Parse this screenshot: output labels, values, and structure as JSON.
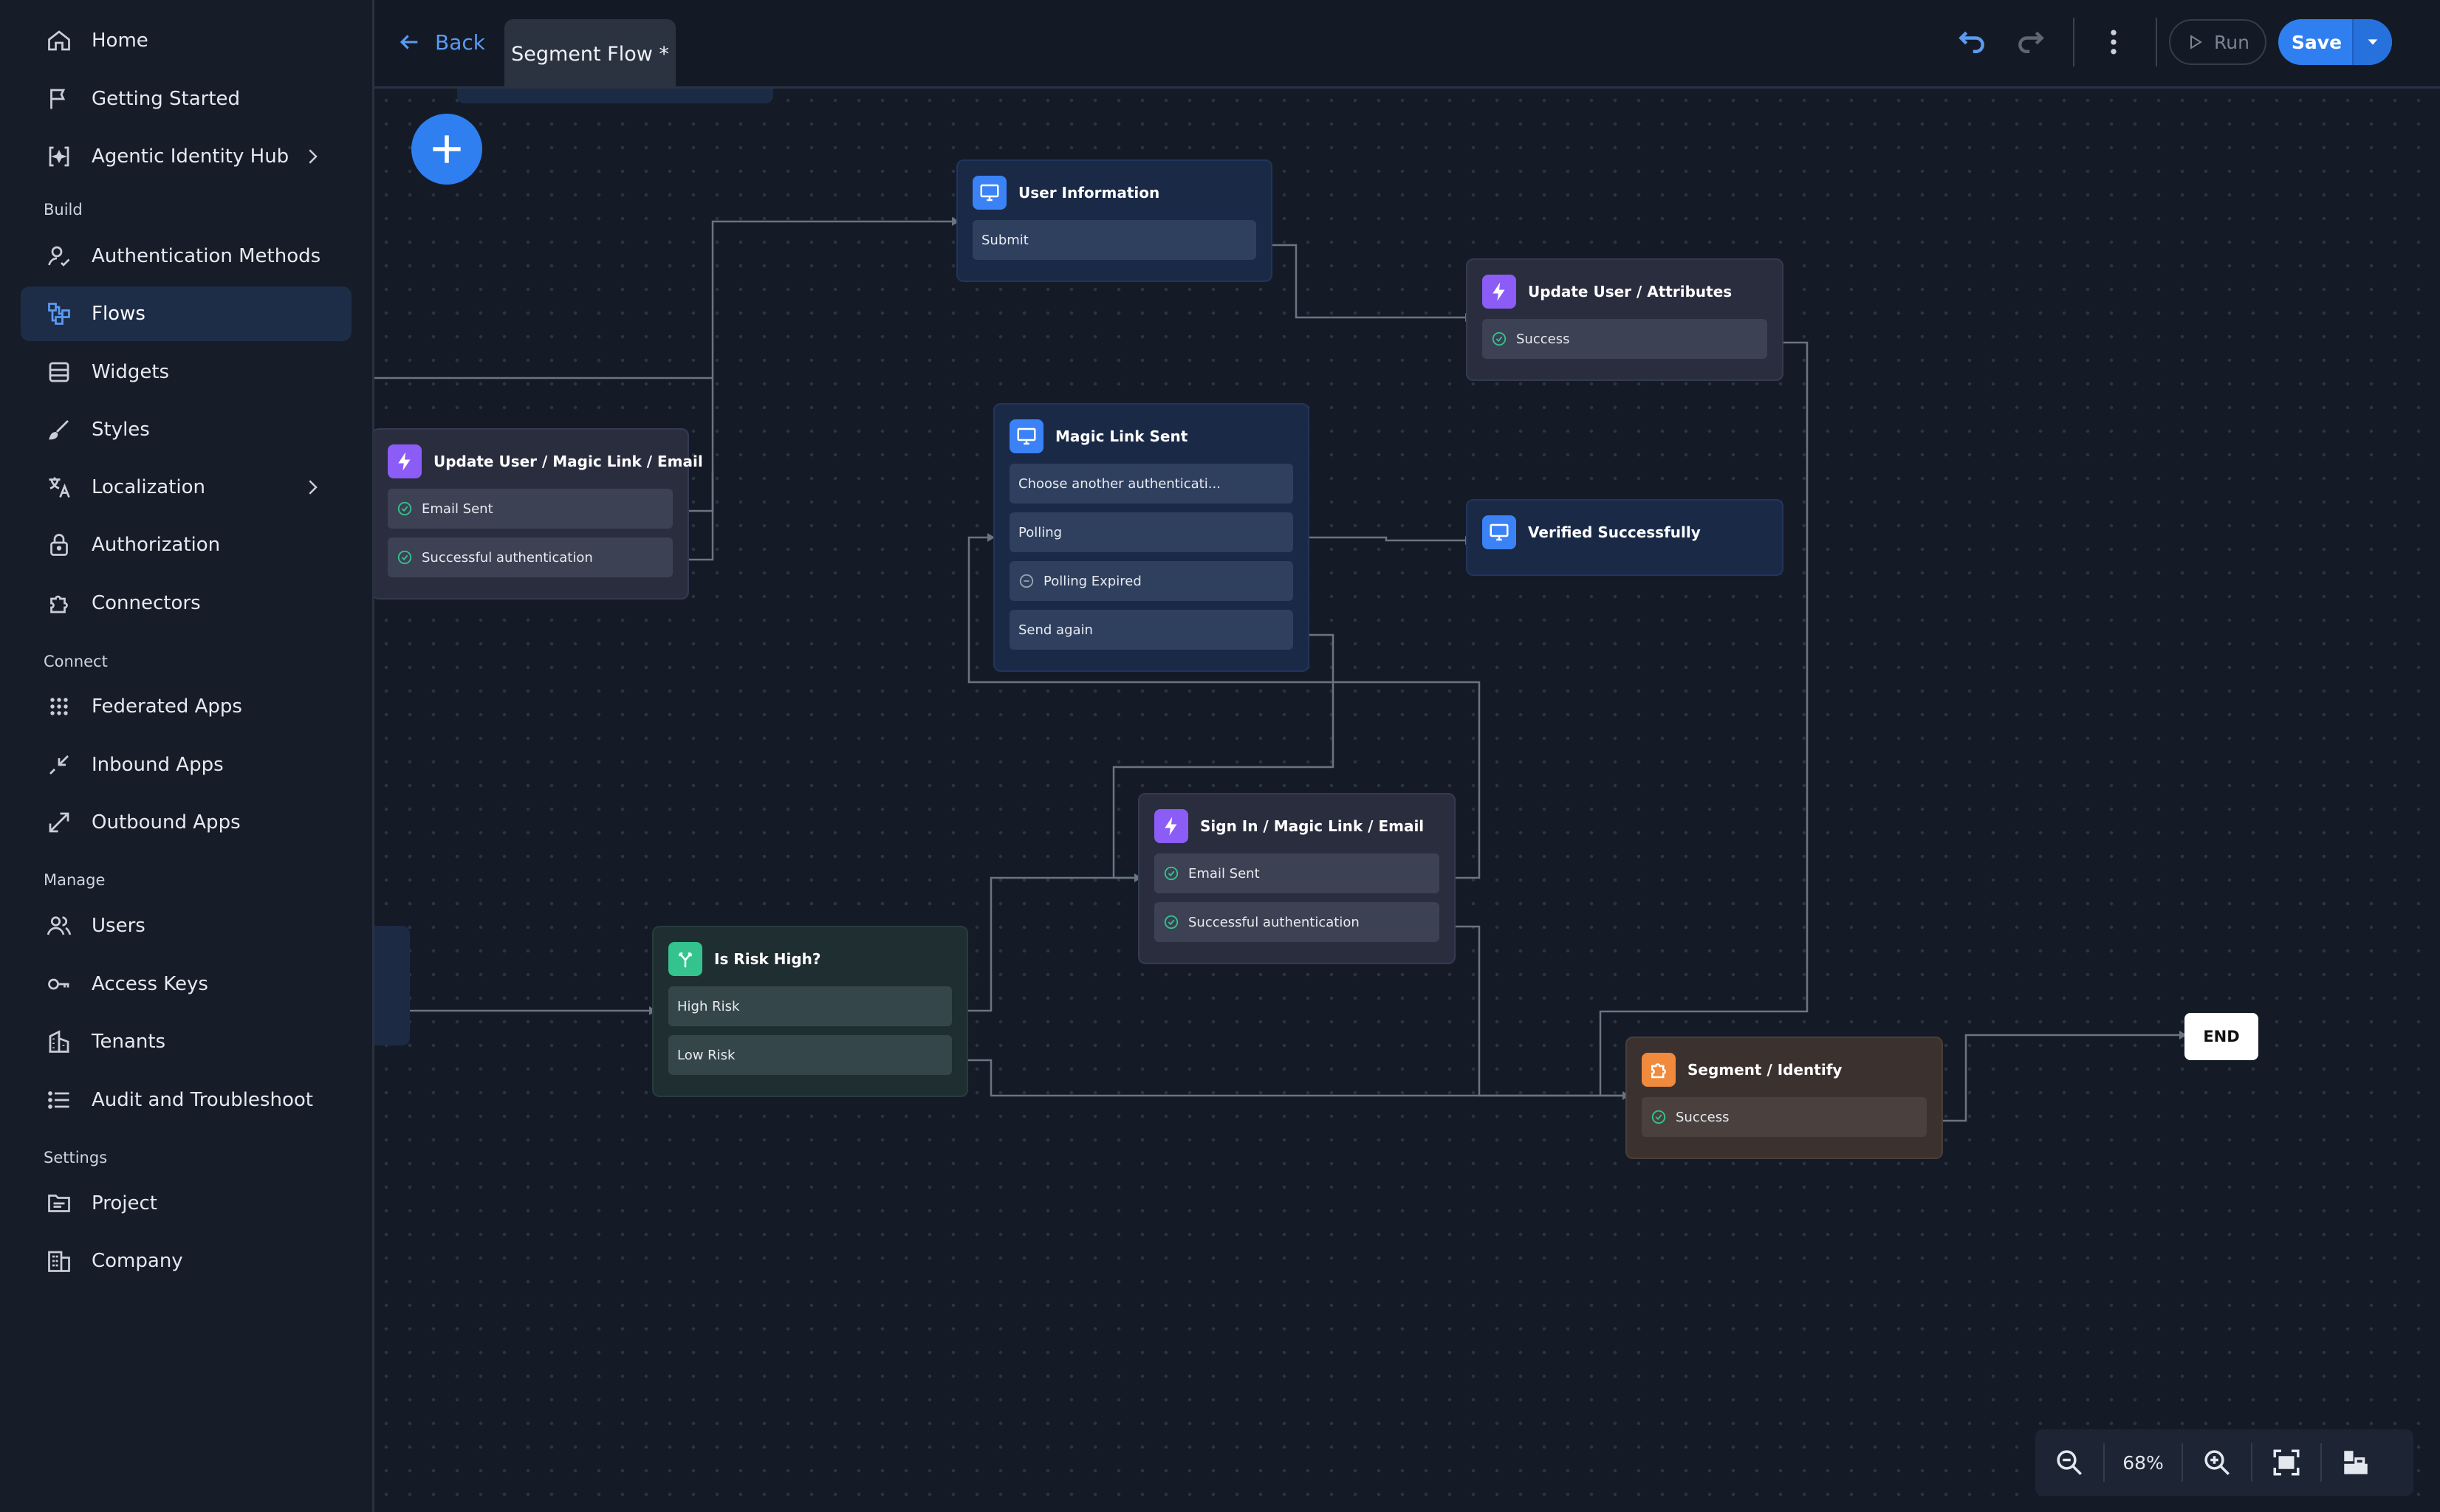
{
  "sidebar": {
    "top_items": [
      {
        "label": "Home",
        "icon": "home-icon"
      },
      {
        "label": "Getting Started",
        "icon": "flag-icon"
      },
      {
        "label": "Agentic Identity Hub",
        "icon": "agent-icon"
      }
    ],
    "sections": [
      {
        "label": "Build",
        "items": [
          {
            "label": "Authentication Methods",
            "icon": "user-check-icon"
          },
          {
            "label": "Flows",
            "icon": "flows-icon",
            "active": true
          },
          {
            "label": "Widgets",
            "icon": "widgets-icon"
          },
          {
            "label": "Styles",
            "icon": "brush-icon"
          },
          {
            "label": "Localization",
            "icon": "translate-icon"
          },
          {
            "label": "Authorization",
            "icon": "lock-icon"
          },
          {
            "label": "Connectors",
            "icon": "puzzle-icon"
          }
        ]
      },
      {
        "label": "Connect",
        "items": [
          {
            "label": "Federated Apps",
            "icon": "grid-icon"
          },
          {
            "label": "Inbound Apps",
            "icon": "inbound-icon"
          },
          {
            "label": "Outbound Apps",
            "icon": "outbound-icon"
          }
        ]
      },
      {
        "label": "Manage",
        "items": [
          {
            "label": "Users",
            "icon": "users-icon"
          },
          {
            "label": "Access Keys",
            "icon": "key-icon"
          },
          {
            "label": "Tenants",
            "icon": "building-icon"
          },
          {
            "label": "Audit and Troubleshoot",
            "icon": "list-icon"
          }
        ]
      },
      {
        "label": "Settings",
        "items": [
          {
            "label": "Project",
            "icon": "folder-icon"
          },
          {
            "label": "Company",
            "icon": "company-icon"
          }
        ]
      }
    ]
  },
  "topbar": {
    "back_label": "Back",
    "tab_label": "Segment Flow *",
    "run_label": "Run",
    "save_label": "Save"
  },
  "canvas": {
    "nodes": {
      "user_information": {
        "title": "User Information",
        "type": "screen",
        "ports": [
          "Submit"
        ]
      },
      "update_attributes": {
        "title": "Update User / Attributes",
        "type": "action",
        "ports": [
          "Success"
        ]
      },
      "update_magic_link": {
        "title": "Update User / Magic Link / Email",
        "type": "action",
        "ports": [
          "Email Sent",
          "Successful authentication"
        ]
      },
      "magic_link_sent": {
        "title": "Magic Link Sent",
        "type": "screen",
        "ports": [
          "Choose another authenticati...",
          "Polling",
          "Polling Expired",
          "Send again"
        ]
      },
      "verified_successfully": {
        "title": "Verified Successfully",
        "type": "screen",
        "ports": []
      },
      "sign_in_magic_link": {
        "title": "Sign In / Magic Link / Email",
        "type": "action",
        "ports": [
          "Email Sent",
          "Successful authentication"
        ]
      },
      "is_risk_high": {
        "title": "Is Risk High?",
        "type": "condition",
        "ports": [
          "High Risk",
          "Low Risk"
        ]
      },
      "segment_identify": {
        "title": "Segment / Identify",
        "type": "connector",
        "ports": [
          "Success"
        ]
      },
      "end": {
        "title": "END"
      }
    },
    "zoom_level": "68%"
  },
  "colors": {
    "accent": "#2f7ff0",
    "screen_icon": "#3b82f6",
    "action_icon": "#8b5cf6",
    "condition_icon": "#34c38f",
    "connector_icon": "#f08a3c"
  }
}
